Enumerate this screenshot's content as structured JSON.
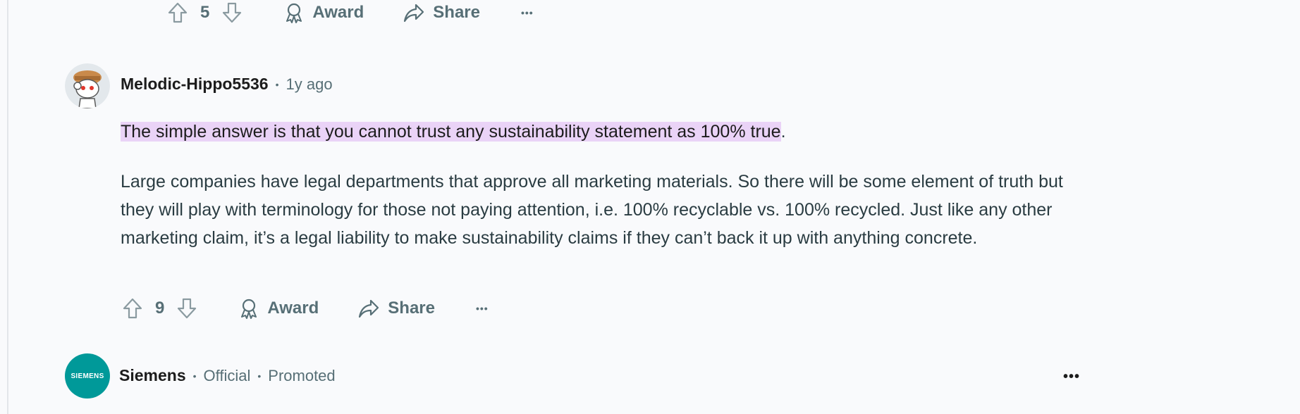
{
  "top_actions": {
    "vote_count": "5",
    "award_label": "Award",
    "share_label": "Share",
    "more": "•••"
  },
  "comment": {
    "author": "Melodic-Hippo5536",
    "separator": "•",
    "time": "1y ago",
    "highlighted": "The simple answer is that you cannot trust any sustainability statement as 100% true",
    "highlight_tail": ".",
    "paragraph": "Large companies have legal departments that approve all marketing materials. So there will be some element of truth but they will play with terminology for those not paying attention, i.e. 100% recyclable vs. 100% recycled. Just like any other marketing claim, it’s a legal liability to make sustainability claims if they can’t back it up with anything concrete.",
    "vote_count": "9",
    "award_label": "Award",
    "share_label": "Share",
    "more": "•••"
  },
  "promoted": {
    "logo_text": "SIEMENS",
    "author": "Siemens",
    "separator": "•",
    "official": "Official",
    "promoted_label": "Promoted",
    "more": "•••"
  },
  "colors": {
    "highlight": "#ead3f7",
    "siemens_teal": "#009999",
    "muted": "#576f76"
  }
}
